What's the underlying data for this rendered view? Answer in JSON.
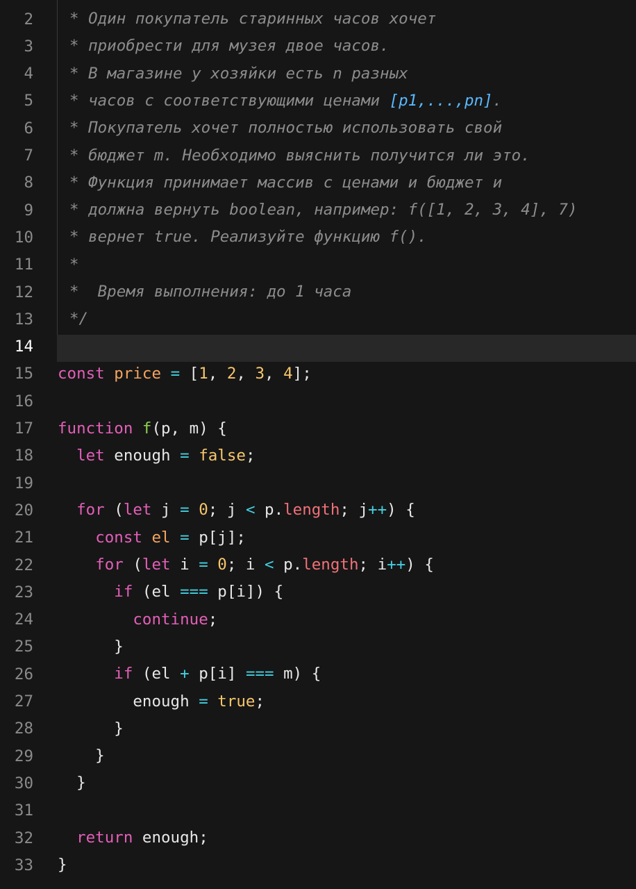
{
  "editor": {
    "active_line": "14",
    "lines": [
      {
        "n": "2",
        "tokens": [
          {
            "t": "* Один покупатель старинных часов хочет",
            "c": "comment"
          }
        ]
      },
      {
        "n": "3",
        "tokens": [
          {
            "t": "* приобрести для музея двое часов.",
            "c": "comment"
          }
        ]
      },
      {
        "n": "4",
        "tokens": [
          {
            "t": "* В магазине у хозяйки есть n разных",
            "c": "comment"
          }
        ]
      },
      {
        "n": "5",
        "tokens": [
          {
            "t": "* часов с соответствующими ценами ",
            "c": "comment"
          },
          {
            "t": "[p1,...,pn]",
            "c": "hl"
          },
          {
            "t": ".",
            "c": "comment"
          }
        ]
      },
      {
        "n": "6",
        "tokens": [
          {
            "t": "* Покупатель хочет полностью использовать свой",
            "c": "comment"
          }
        ]
      },
      {
        "n": "7",
        "tokens": [
          {
            "t": "* бюджет m. Необходимо выяснить получится ли это.",
            "c": "comment"
          }
        ]
      },
      {
        "n": "8",
        "tokens": [
          {
            "t": "* Функция принимает массив с ценами и бюджет и",
            "c": "comment"
          }
        ]
      },
      {
        "n": "9",
        "tokens": [
          {
            "t": "* должна вернуть boolean, например: f([1, 2, 3, 4], 7)",
            "c": "comment"
          }
        ]
      },
      {
        "n": "10",
        "tokens": [
          {
            "t": "* вернет true. Реализуйте функцию f().",
            "c": "comment"
          }
        ]
      },
      {
        "n": "11",
        "tokens": [
          {
            "t": "*",
            "c": "comment"
          }
        ]
      },
      {
        "n": "12",
        "tokens": [
          {
            "t": "*  Время выполнения: до 1 часа",
            "c": "comment"
          }
        ]
      },
      {
        "n": "13",
        "tokens": [
          {
            "t": "*/",
            "c": "comment"
          }
        ]
      },
      {
        "n": "14",
        "tokens": []
      },
      {
        "n": "15",
        "tokens": [
          {
            "t": "const",
            "c": "kw"
          },
          {
            "t": " ",
            "c": "txt"
          },
          {
            "t": "price",
            "c": "var"
          },
          {
            "t": " ",
            "c": "txt"
          },
          {
            "t": "=",
            "c": "op"
          },
          {
            "t": " [",
            "c": "txt"
          },
          {
            "t": "1",
            "c": "num"
          },
          {
            "t": ", ",
            "c": "txt"
          },
          {
            "t": "2",
            "c": "num"
          },
          {
            "t": ", ",
            "c": "txt"
          },
          {
            "t": "3",
            "c": "num"
          },
          {
            "t": ", ",
            "c": "txt"
          },
          {
            "t": "4",
            "c": "num"
          },
          {
            "t": "];",
            "c": "txt"
          }
        ]
      },
      {
        "n": "16",
        "tokens": []
      },
      {
        "n": "17",
        "tokens": [
          {
            "t": "function",
            "c": "kw"
          },
          {
            "t": " ",
            "c": "txt"
          },
          {
            "t": "f",
            "c": "fn"
          },
          {
            "t": "(p, m) {",
            "c": "txt"
          }
        ]
      },
      {
        "n": "18",
        "tokens": [
          {
            "t": "  ",
            "c": "txt"
          },
          {
            "t": "let",
            "c": "kw"
          },
          {
            "t": " enough ",
            "c": "txt"
          },
          {
            "t": "=",
            "c": "op"
          },
          {
            "t": " ",
            "c": "txt"
          },
          {
            "t": "false",
            "c": "bool"
          },
          {
            "t": ";",
            "c": "txt"
          }
        ]
      },
      {
        "n": "19",
        "tokens": []
      },
      {
        "n": "20",
        "tokens": [
          {
            "t": "  ",
            "c": "txt"
          },
          {
            "t": "for",
            "c": "kw"
          },
          {
            "t": " (",
            "c": "txt"
          },
          {
            "t": "let",
            "c": "kw"
          },
          {
            "t": " j ",
            "c": "txt"
          },
          {
            "t": "=",
            "c": "op"
          },
          {
            "t": " ",
            "c": "txt"
          },
          {
            "t": "0",
            "c": "num"
          },
          {
            "t": "; j ",
            "c": "txt"
          },
          {
            "t": "<",
            "c": "op"
          },
          {
            "t": " p.",
            "c": "txt"
          },
          {
            "t": "length",
            "c": "prop"
          },
          {
            "t": "; j",
            "c": "txt"
          },
          {
            "t": "++",
            "c": "op"
          },
          {
            "t": ") {",
            "c": "txt"
          }
        ]
      },
      {
        "n": "21",
        "tokens": [
          {
            "t": "    ",
            "c": "txt"
          },
          {
            "t": "const",
            "c": "kw"
          },
          {
            "t": " ",
            "c": "txt"
          },
          {
            "t": "el",
            "c": "var"
          },
          {
            "t": " ",
            "c": "txt"
          },
          {
            "t": "=",
            "c": "op"
          },
          {
            "t": " p[j];",
            "c": "txt"
          }
        ]
      },
      {
        "n": "22",
        "tokens": [
          {
            "t": "    ",
            "c": "txt"
          },
          {
            "t": "for",
            "c": "kw"
          },
          {
            "t": " (",
            "c": "txt"
          },
          {
            "t": "let",
            "c": "kw"
          },
          {
            "t": " i ",
            "c": "txt"
          },
          {
            "t": "=",
            "c": "op"
          },
          {
            "t": " ",
            "c": "txt"
          },
          {
            "t": "0",
            "c": "num"
          },
          {
            "t": "; i ",
            "c": "txt"
          },
          {
            "t": "<",
            "c": "op"
          },
          {
            "t": " p.",
            "c": "txt"
          },
          {
            "t": "length",
            "c": "prop"
          },
          {
            "t": "; i",
            "c": "txt"
          },
          {
            "t": "++",
            "c": "op"
          },
          {
            "t": ") {",
            "c": "txt"
          }
        ]
      },
      {
        "n": "23",
        "tokens": [
          {
            "t": "      ",
            "c": "txt"
          },
          {
            "t": "if",
            "c": "kw"
          },
          {
            "t": " (el ",
            "c": "txt"
          },
          {
            "t": "===",
            "c": "op"
          },
          {
            "t": " p[i]) {",
            "c": "txt"
          }
        ]
      },
      {
        "n": "24",
        "tokens": [
          {
            "t": "        ",
            "c": "txt"
          },
          {
            "t": "continue",
            "c": "kw"
          },
          {
            "t": ";",
            "c": "txt"
          }
        ]
      },
      {
        "n": "25",
        "tokens": [
          {
            "t": "      }",
            "c": "txt"
          }
        ]
      },
      {
        "n": "26",
        "tokens": [
          {
            "t": "      ",
            "c": "txt"
          },
          {
            "t": "if",
            "c": "kw"
          },
          {
            "t": " (el ",
            "c": "txt"
          },
          {
            "t": "+",
            "c": "op"
          },
          {
            "t": " p[i] ",
            "c": "txt"
          },
          {
            "t": "===",
            "c": "op"
          },
          {
            "t": " m) {",
            "c": "txt"
          }
        ]
      },
      {
        "n": "27",
        "tokens": [
          {
            "t": "        enough ",
            "c": "txt"
          },
          {
            "t": "=",
            "c": "op"
          },
          {
            "t": " ",
            "c": "txt"
          },
          {
            "t": "true",
            "c": "bool"
          },
          {
            "t": ";",
            "c": "txt"
          }
        ]
      },
      {
        "n": "28",
        "tokens": [
          {
            "t": "      }",
            "c": "txt"
          }
        ]
      },
      {
        "n": "29",
        "tokens": [
          {
            "t": "    }",
            "c": "txt"
          }
        ]
      },
      {
        "n": "30",
        "tokens": [
          {
            "t": "  }",
            "c": "txt"
          }
        ]
      },
      {
        "n": "31",
        "tokens": []
      },
      {
        "n": "32",
        "tokens": [
          {
            "t": "  ",
            "c": "txt"
          },
          {
            "t": "return",
            "c": "kw"
          },
          {
            "t": " enough;",
            "c": "txt"
          }
        ]
      },
      {
        "n": "33",
        "tokens": [
          {
            "t": "}",
            "c": "txt"
          }
        ]
      }
    ]
  }
}
